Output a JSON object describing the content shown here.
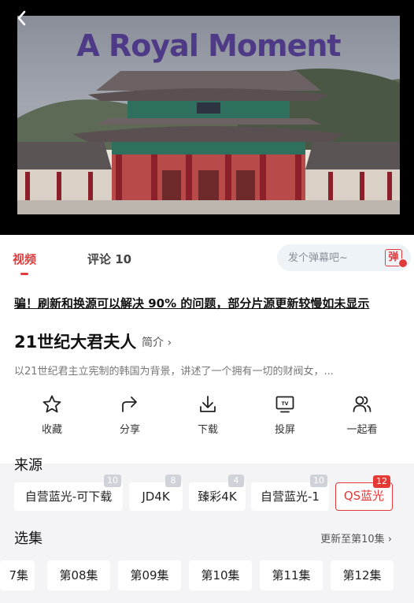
{
  "player": {
    "overlay_title": "A Royal Moment",
    "gate_sign": "敦化門"
  },
  "tabs": {
    "video": "视频",
    "comments": "评论 10"
  },
  "danmaku": {
    "placeholder": "发个弹幕吧~",
    "button_glyph": "弹"
  },
  "notice": "骗！刷新和换源可以解决 90% 的问题，部分片源更新较慢如未显示",
  "show": {
    "title": "21世纪大君夫人",
    "intro_link": "简介 ›",
    "description": "以21世纪君主立宪制的韩国为背景，讲述了一个拥有一切的财阀女，..."
  },
  "actions": [
    {
      "label": "收藏",
      "icon": "star-icon"
    },
    {
      "label": "分享",
      "icon": "share-icon"
    },
    {
      "label": "下载",
      "icon": "download-icon"
    },
    {
      "label": "投屏",
      "icon": "tv-cast-icon"
    },
    {
      "label": "一起看",
      "icon": "users-icon"
    }
  ],
  "sources": {
    "title": "来源",
    "items": [
      {
        "label": "自营蓝光-可下载",
        "count": "10"
      },
      {
        "label": "JD4K",
        "count": "8"
      },
      {
        "label": "臻彩4K",
        "count": "4"
      },
      {
        "label": "自营蓝光-1",
        "count": "10"
      },
      {
        "label": "QS蓝光",
        "count": "12",
        "selected": true
      }
    ]
  },
  "episodes": {
    "title": "选集",
    "update_info": "更新至第10集 ›",
    "items": [
      "7集",
      "第08集",
      "第09集",
      "第10集",
      "第11集",
      "第12集"
    ]
  },
  "colors": {
    "accent": "#e03a3a",
    "title_overlay": "#4e3a86"
  }
}
